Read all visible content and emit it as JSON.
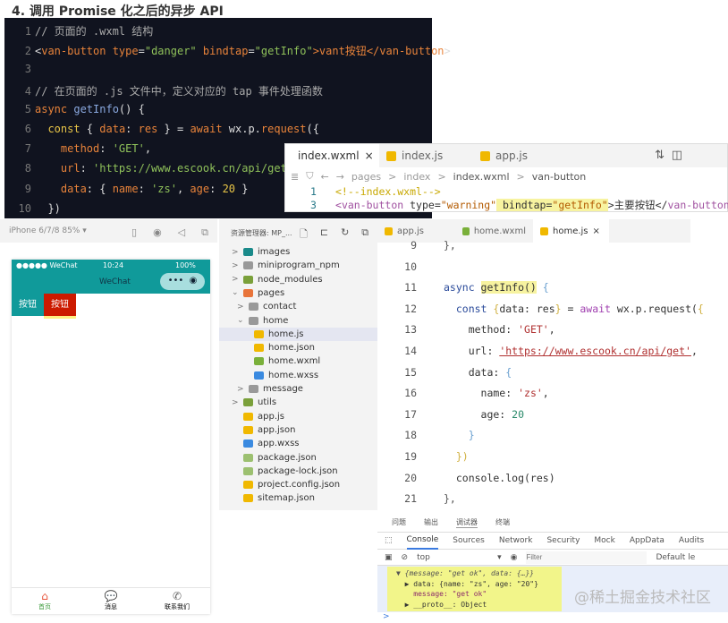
{
  "heading": "4. 调用 Promise 化之后的异步 API",
  "slide_code": [
    [
      [
        "// 页面的 .wxml 结构",
        "#aaa"
      ]
    ],
    [
      [
        "<",
        "#ddd"
      ],
      [
        "van-button",
        "#e8833a"
      ],
      [
        " type",
        "#e8833a"
      ],
      [
        "=",
        "#ddd"
      ],
      [
        "\"danger\"",
        "#8fc15a"
      ],
      [
        " bindtap",
        "#e8833a"
      ],
      [
        "=",
        "#ddd"
      ],
      [
        "\"getInfo\"",
        "#8fc15a"
      ],
      [
        ">vant按钮</",
        "#e8833a"
      ],
      [
        "van-button",
        "#e8833a"
      ],
      [
        ">",
        "#ddd"
      ]
    ],
    [],
    [
      [
        "// 在页面的 .js 文件中，定义对应的 tap 事件处理函数",
        "#aaa"
      ]
    ],
    [
      [
        "async",
        "#e8833a"
      ],
      [
        " getInfo",
        "#8aa9e0"
      ],
      [
        "() {",
        "#ddd"
      ]
    ],
    [
      [
        "  const",
        "#e8c547"
      ],
      [
        " { ",
        "#ddd"
      ],
      [
        "data",
        "#e8833a"
      ],
      [
        ": ",
        "#ddd"
      ],
      [
        "res",
        "#e8833a"
      ],
      [
        " } = ",
        "#ddd"
      ],
      [
        "await",
        "#e8833a"
      ],
      [
        " wx.p.",
        "#ddd"
      ],
      [
        "request",
        "#e8833a"
      ],
      [
        "({",
        "#ddd"
      ]
    ],
    [
      [
        "    method",
        "#e8833a"
      ],
      [
        ": ",
        "#ddd"
      ],
      [
        "'GET'",
        "#8fc15a"
      ],
      [
        ",",
        "#ddd"
      ]
    ],
    [
      [
        "    url",
        "#e8833a"
      ],
      [
        ": ",
        "#ddd"
      ],
      [
        "'https://www.escook.cn/api/get'",
        "#8fc15a"
      ],
      [
        ",",
        "#ddd"
      ]
    ],
    [
      [
        "    data",
        "#e8833a"
      ],
      [
        ": { ",
        "#ddd"
      ],
      [
        "name",
        "#e8833a"
      ],
      [
        ": ",
        "#ddd"
      ],
      [
        "'zs'",
        "#8fc15a"
      ],
      [
        ", ",
        "#ddd"
      ],
      [
        "age",
        "#e8833a"
      ],
      [
        ": ",
        "#ddd"
      ],
      [
        "20",
        "#e8c547"
      ],
      [
        " }",
        "#ddd"
      ]
    ],
    [
      [
        "  })",
        "#ddd"
      ]
    ]
  ],
  "overlay": {
    "tabs": [
      "index.wxml",
      "index.js",
      "app.js"
    ],
    "close": "×",
    "breadcrumb": [
      "pages",
      "index",
      "index.wxml",
      "van-button"
    ],
    "sep": ">",
    "lines": [
      {
        "n": "1",
        "tokens": [
          [
            "<!--index.wxml-->",
            "#c8a800"
          ]
        ]
      },
      {
        "n": "3",
        "tokens": [
          [
            "<",
            "#a050a0"
          ],
          [
            "van-button",
            "#a050a0"
          ],
          [
            " type",
            "#333"
          ],
          [
            "=",
            "#333"
          ],
          [
            "\"warning\"",
            "#b35a00"
          ],
          [
            " bindtap",
            "#333"
          ],
          [
            "=",
            "#333"
          ],
          [
            "\"getInfo\"",
            "#b35a00"
          ],
          [
            ">主要按钮</",
            "#333"
          ],
          [
            "van-button",
            "#a050a0"
          ],
          [
            ">",
            "#a050a0"
          ]
        ]
      }
    ]
  },
  "simulator": {
    "device": "iPhone 6/7/8 85% ▾",
    "carrier": "●●●●● WeChat",
    "time": "10:24",
    "battery": "100%",
    "nav_title": "WeChat",
    "buttons": [
      "按钮",
      "按钮"
    ],
    "tabbar": [
      "首页",
      "消息",
      "联系我们"
    ]
  },
  "explorer": {
    "title": "资源管理器: MP_...",
    "items": [
      {
        "label": "images",
        "lvl": 0,
        "arrow": ">",
        "color": "#1a8a8a"
      },
      {
        "label": "miniprogram_npm",
        "lvl": 0,
        "arrow": ">",
        "color": "#999"
      },
      {
        "label": "node_modules",
        "lvl": 0,
        "arrow": ">",
        "color": "#7aa03a"
      },
      {
        "label": "pages",
        "lvl": 0,
        "arrow": "⌄",
        "color": "#e8743a"
      },
      {
        "label": "contact",
        "lvl": 1,
        "arrow": ">",
        "color": "#999"
      },
      {
        "label": "home",
        "lvl": 1,
        "arrow": "⌄",
        "color": "#999"
      },
      {
        "label": "home.js",
        "lvl": 2,
        "arrow": "",
        "color": "#f0b800"
      },
      {
        "label": "home.json",
        "lvl": 2,
        "arrow": "",
        "color": "#f0b800"
      },
      {
        "label": "home.wxml",
        "lvl": 2,
        "arrow": "",
        "color": "#7ab03a"
      },
      {
        "label": "home.wxss",
        "lvl": 2,
        "arrow": "",
        "color": "#3a8ae0"
      },
      {
        "label": "message",
        "lvl": 1,
        "arrow": ">",
        "color": "#999"
      },
      {
        "label": "utils",
        "lvl": 0,
        "arrow": ">",
        "color": "#7aa03a"
      },
      {
        "label": "app.js",
        "lvl": 0,
        "arrow": "",
        "color": "#f0b800"
      },
      {
        "label": "app.json",
        "lvl": 0,
        "arrow": "",
        "color": "#f0b800"
      },
      {
        "label": "app.wxss",
        "lvl": 0,
        "arrow": "",
        "color": "#3a8ae0"
      },
      {
        "label": "package.json",
        "lvl": 0,
        "arrow": "",
        "color": "#9cc070"
      },
      {
        "label": "package-lock.json",
        "lvl": 0,
        "arrow": "",
        "color": "#9cc070"
      },
      {
        "label": "project.config.json",
        "lvl": 0,
        "arrow": "",
        "color": "#f0b800"
      },
      {
        "label": "sitemap.json",
        "lvl": 0,
        "arrow": "",
        "color": "#f0b800"
      }
    ],
    "selected": "home.js"
  },
  "editor": {
    "tabs": [
      "app.js",
      "home.wxml",
      "home.js"
    ],
    "close": "×",
    "lines": [
      {
        "n": "9",
        "tokens": [
          [
            "},",
            "#555"
          ]
        ]
      },
      {
        "n": "10",
        "tokens": []
      },
      {
        "n": "11",
        "tokens": [
          [
            "async ",
            "#2a4a9a"
          ],
          [
            "getInfo()",
            "#333"
          ],
          [
            " {",
            "#6aa0d0"
          ]
        ]
      },
      {
        "n": "12",
        "tokens": [
          [
            "  const ",
            "#2a4a9a"
          ],
          [
            "{",
            "#d0b040"
          ],
          [
            "data: res",
            "#333"
          ],
          [
            "}",
            "#d0b040"
          ],
          [
            " = ",
            "#333"
          ],
          [
            "await ",
            "#a040b0"
          ],
          [
            "wx.p.request(",
            "#333"
          ],
          [
            "{",
            "#d0b040"
          ]
        ]
      },
      {
        "n": "13",
        "tokens": [
          [
            "    method: ",
            "#333"
          ],
          [
            "'GET'",
            "#b03030"
          ],
          [
            ",",
            "#333"
          ]
        ]
      },
      {
        "n": "14",
        "tokens": [
          [
            "    url: ",
            "#333"
          ],
          [
            "'https://www.escook.cn/api/get'",
            "#b03030"
          ],
          [
            ",",
            "#333"
          ]
        ]
      },
      {
        "n": "15",
        "tokens": [
          [
            "    data: ",
            "#333"
          ],
          [
            "{",
            "#6aa0d0"
          ]
        ]
      },
      {
        "n": "16",
        "tokens": [
          [
            "      name: ",
            "#333"
          ],
          [
            "'zs'",
            "#b03030"
          ],
          [
            ",",
            "#333"
          ]
        ]
      },
      {
        "n": "17",
        "tokens": [
          [
            "      age: ",
            "#333"
          ],
          [
            "20",
            "#2a8a6a"
          ]
        ]
      },
      {
        "n": "18",
        "tokens": [
          [
            "    }",
            "#6aa0d0"
          ]
        ]
      },
      {
        "n": "19",
        "tokens": [
          [
            "  })",
            "#d0b040"
          ]
        ]
      },
      {
        "n": "20",
        "tokens": [
          [
            "  console.log(res)",
            "#333"
          ]
        ]
      },
      {
        "n": "21",
        "tokens": [
          [
            "},",
            "#555"
          ]
        ]
      }
    ]
  },
  "devtools": {
    "panels": [
      "问题",
      "输出",
      "调试器",
      "终端"
    ],
    "tabs": [
      "Console",
      "Sources",
      "Network",
      "Security",
      "Mock",
      "AppData",
      "Audits"
    ],
    "context": "top",
    "filter_placeholder": "Filter",
    "levels": "Default le",
    "output": [
      "▼ {message: \"get ok\", data: {…}}",
      "  ▶ data: {name: \"zs\", age: \"20\"}",
      "    message: \"get ok\"",
      "  ▶ __proto__: Object"
    ],
    "prompt": ">"
  },
  "watermark": "@稀土掘金技术社区"
}
